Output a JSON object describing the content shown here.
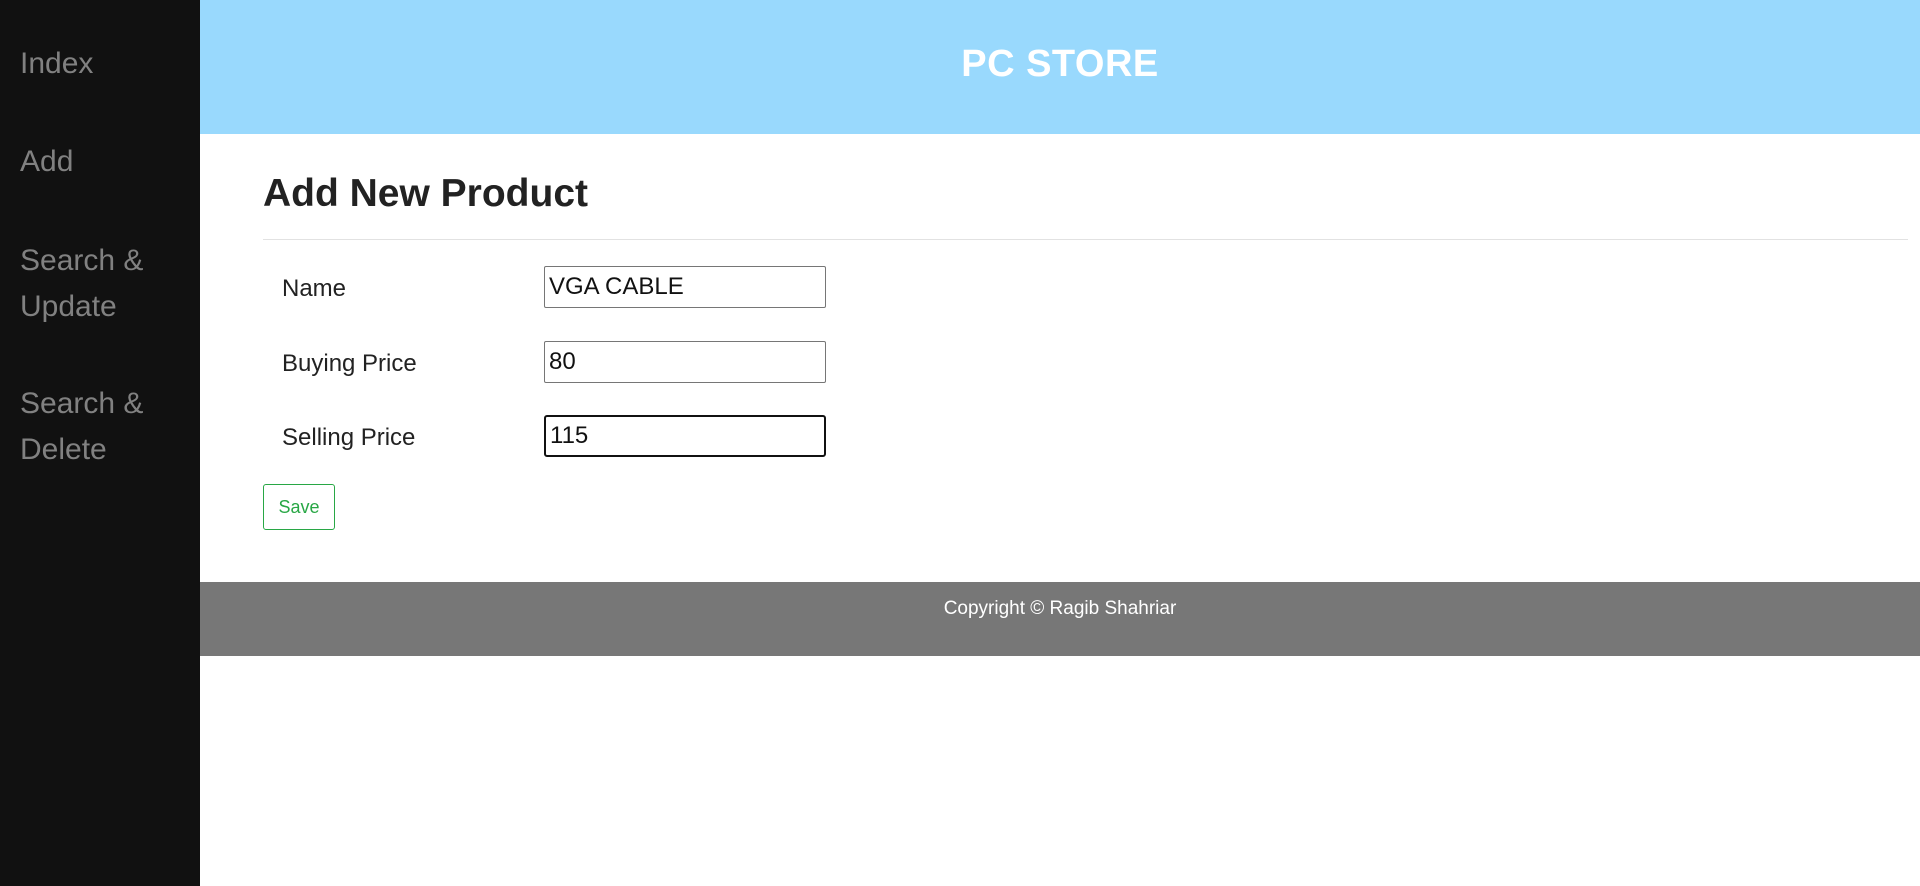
{
  "sidebar": {
    "items": [
      {
        "label": "Index"
      },
      {
        "label": "Add"
      },
      {
        "label": "Search & Update"
      },
      {
        "label": "Search & Delete"
      }
    ]
  },
  "header": {
    "title": "PC STORE"
  },
  "form": {
    "title": "Add New Product",
    "fields": [
      {
        "label": "Name",
        "value": "VGA CABLE"
      },
      {
        "label": "Buying Price",
        "value": "80"
      },
      {
        "label": "Selling Price",
        "value": "115"
      }
    ],
    "save_label": "Save"
  },
  "footer": {
    "text": "Copyright © Ragib Shahriar"
  },
  "colors": {
    "sidebar_bg": "#111111",
    "sidebar_text": "#818181",
    "header_bg": "#99d9fd",
    "footer_bg": "#777777",
    "save_accent": "#28a745"
  }
}
